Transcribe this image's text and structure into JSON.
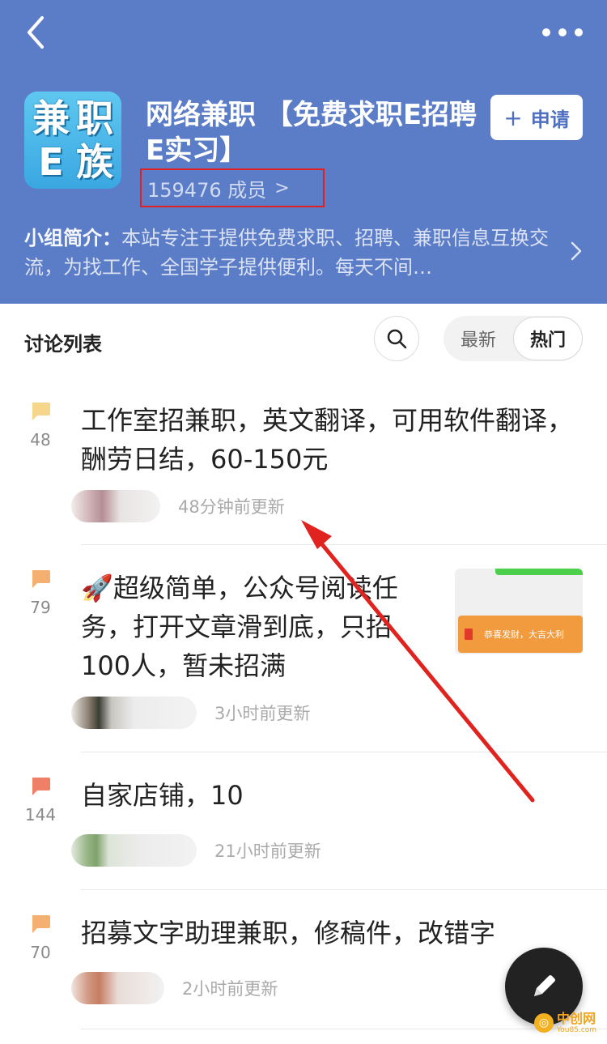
{
  "header": {
    "logo_chars": [
      "兼",
      "职",
      "E",
      "族"
    ],
    "title": "网络兼职 【免费求职E招聘E实习】",
    "members": "159476 成员",
    "apply_label": "申请",
    "intro_label": "小组简介：",
    "intro_text": "本站专注于提供免费求职、招聘、兼职信息互换交流，为找工作、全国学子提供便利。每天不间…",
    "bg_color": "#5b7cc7"
  },
  "list": {
    "title": "讨论列表",
    "sort_latest": "最新",
    "sort_hot": "热门"
  },
  "posts": [
    {
      "count": "48",
      "title": "工作室招兼职，英文翻译，可用软件翻译，酬劳日结，60-150元",
      "time": "48分钟前更新",
      "bubble_color": "#f6d68a"
    },
    {
      "count": "79",
      "title": "🚀超级简单，公众号阅读任务，打开文章滑到底，只招100人，暂未招满",
      "time": "3小时前更新",
      "bubble_color": "#f3b070",
      "thumb_text": "恭喜发财，大吉大利"
    },
    {
      "count": "144",
      "title": "自家店铺，10",
      "time": "21小时前更新",
      "bubble_color": "#ef7f66"
    },
    {
      "count": "70",
      "title": "招募文字助理兼职，修稿件，改错字",
      "time": "2小时前更新",
      "bubble_color": "#f3b070"
    }
  ],
  "watermark": {
    "cn": "中创网",
    "en": "You85.com"
  }
}
